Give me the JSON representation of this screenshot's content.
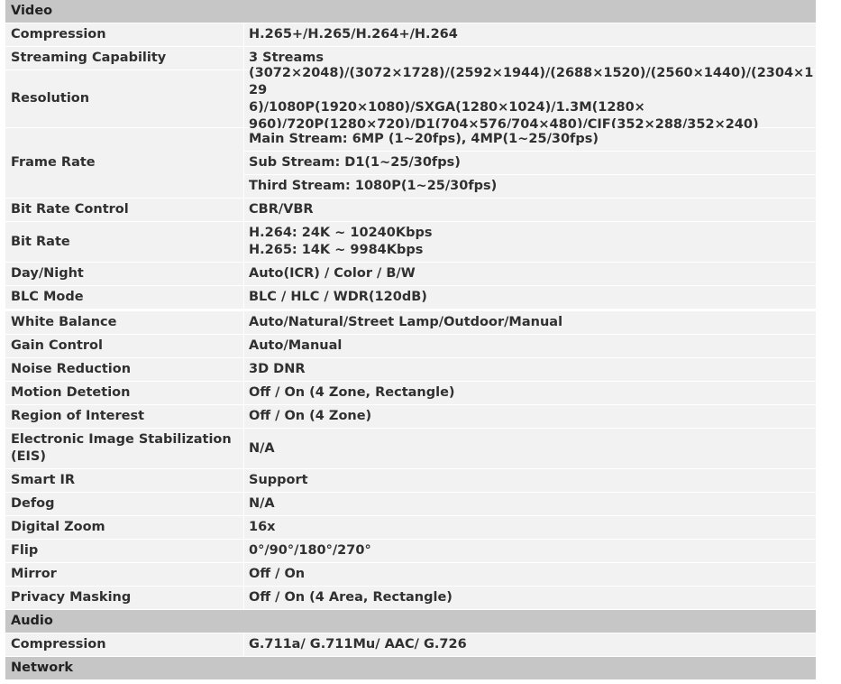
{
  "spec": [
    {
      "section": "Video"
    },
    {
      "label": "Compression",
      "values": [
        "H.265+/H.265/H.264+/H.264"
      ]
    },
    {
      "label": "Streaming Capability",
      "values": [
        "3 Streams"
      ]
    },
    {
      "label": "Resolution",
      "values": [
        "(3072×2048)/(3072×1728)/(2592×1944)/(2688×1520)/(2560×1440)/(2304×129\n6)/1080P(1920×1080)/SXGA(1280×1024)/1.3M(1280×\n960)/720P(1280×720)/D1(704×576/704×480)/CIF(352×288/352×240)"
      ]
    },
    {
      "label": "Frame Rate",
      "values": [
        "Main Stream: 6MP (1~20fps), 4MP(1~25/30fps)",
        "Sub Stream: D1(1~25/30fps)",
        "Third Stream: 1080P(1~25/30fps)"
      ]
    },
    {
      "label": "Bit Rate Control",
      "values": [
        "CBR/VBR"
      ]
    },
    {
      "label": "Bit Rate",
      "values": [
        "H.264: 24K ~ 10240Kbps\nH.265: 14K ~ 9984Kbps"
      ]
    },
    {
      "label": "Day/Night",
      "values": [
        "Auto(ICR) / Color / B/W"
      ]
    },
    {
      "label": "BLC Mode",
      "values": [
        "BLC / HLC / WDR(120dB)"
      ],
      "gapAfter": true
    },
    {
      "label": "White Balance",
      "values": [
        "Auto/Natural/Street Lamp/Outdoor/Manual"
      ]
    },
    {
      "label": "Gain Control",
      "values": [
        "Auto/Manual"
      ]
    },
    {
      "label": "Noise Reduction",
      "values": [
        "3D DNR"
      ]
    },
    {
      "label": "Motion Detetion",
      "values": [
        "Off / On (4 Zone, Rectangle)"
      ]
    },
    {
      "label": "Region of Interest",
      "values": [
        "Off / On (4 Zone)"
      ]
    },
    {
      "label": "Electronic Image Stabilization\n(EIS)",
      "values": [
        "N/A"
      ]
    },
    {
      "label": "Smart IR",
      "values": [
        "Support"
      ]
    },
    {
      "label": "Defog",
      "values": [
        "N/A"
      ]
    },
    {
      "label": "Digital Zoom",
      "values": [
        "16x"
      ]
    },
    {
      "label": "Flip",
      "values": [
        "0°/90°/180°/270°"
      ]
    },
    {
      "label": "Mirror",
      "values": [
        "Off / On"
      ]
    },
    {
      "label": "Privacy Masking",
      "values": [
        "Off / On (4 Area, Rectangle)"
      ]
    },
    {
      "section": "Audio"
    },
    {
      "label": "Compression",
      "values": [
        "G.711a/ G.711Mu/ AAC/ G.726"
      ]
    },
    {
      "section": "Network"
    }
  ],
  "colors": {
    "section_bg": "#c6c6c6",
    "cell_bg": "#f2f2f2",
    "text": "#303030"
  }
}
